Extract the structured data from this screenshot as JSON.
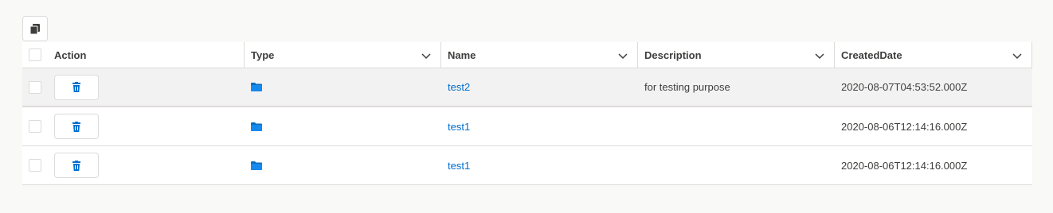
{
  "toolbar": {
    "copy_icon": "copy-icon"
  },
  "columns": [
    {
      "label": "Action"
    },
    {
      "label": "Type"
    },
    {
      "label": "Name"
    },
    {
      "label": "Description"
    },
    {
      "label": "CreatedDate"
    }
  ],
  "rows": [
    {
      "type_icon": "folder-icon",
      "name": "test2",
      "description": "for testing purpose",
      "created": "2020-08-07T04:53:52.000Z"
    },
    {
      "type_icon": "folder-icon",
      "name": "test1",
      "description": "",
      "created": "2020-08-06T12:14:16.000Z"
    },
    {
      "type_icon": "folder-icon",
      "name": "test1",
      "description": "",
      "created": "2020-08-06T12:14:16.000Z"
    }
  ],
  "colors": {
    "link": "#006dcc",
    "icon_blue": "#0070d2",
    "folder": "#0a6ebd"
  }
}
